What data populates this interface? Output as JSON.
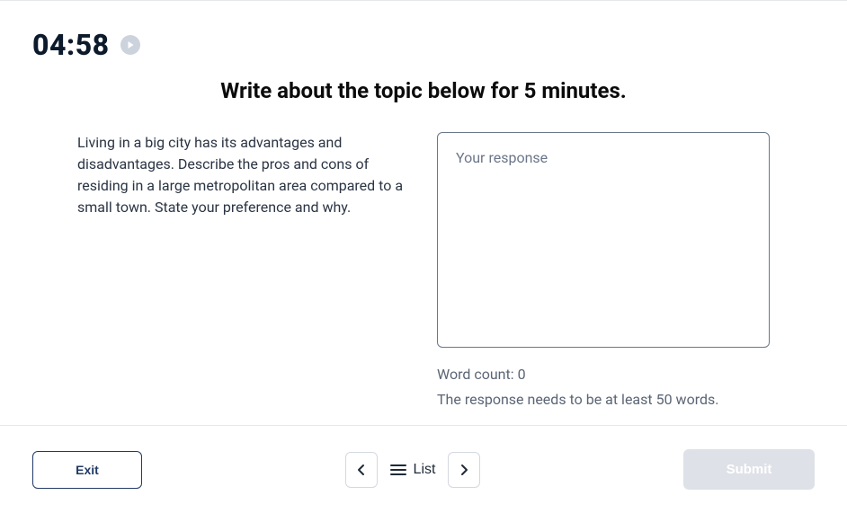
{
  "timer": {
    "display": "04:58"
  },
  "instruction": "Write about the topic below for 5 minutes.",
  "prompt": "Living in a big city has its advantages and disadvantages. Describe the pros and cons of residing in a large metropolitan area compared to a small town. State your preference and why.",
  "response": {
    "value": "",
    "placeholder": "Your response"
  },
  "word_count": {
    "prefix": "Word count: ",
    "value": "0"
  },
  "min_words_hint": "The response needs to be at least 50 words.",
  "footer": {
    "exit_label": "Exit",
    "list_label": "List",
    "submit_label": "Submit"
  }
}
